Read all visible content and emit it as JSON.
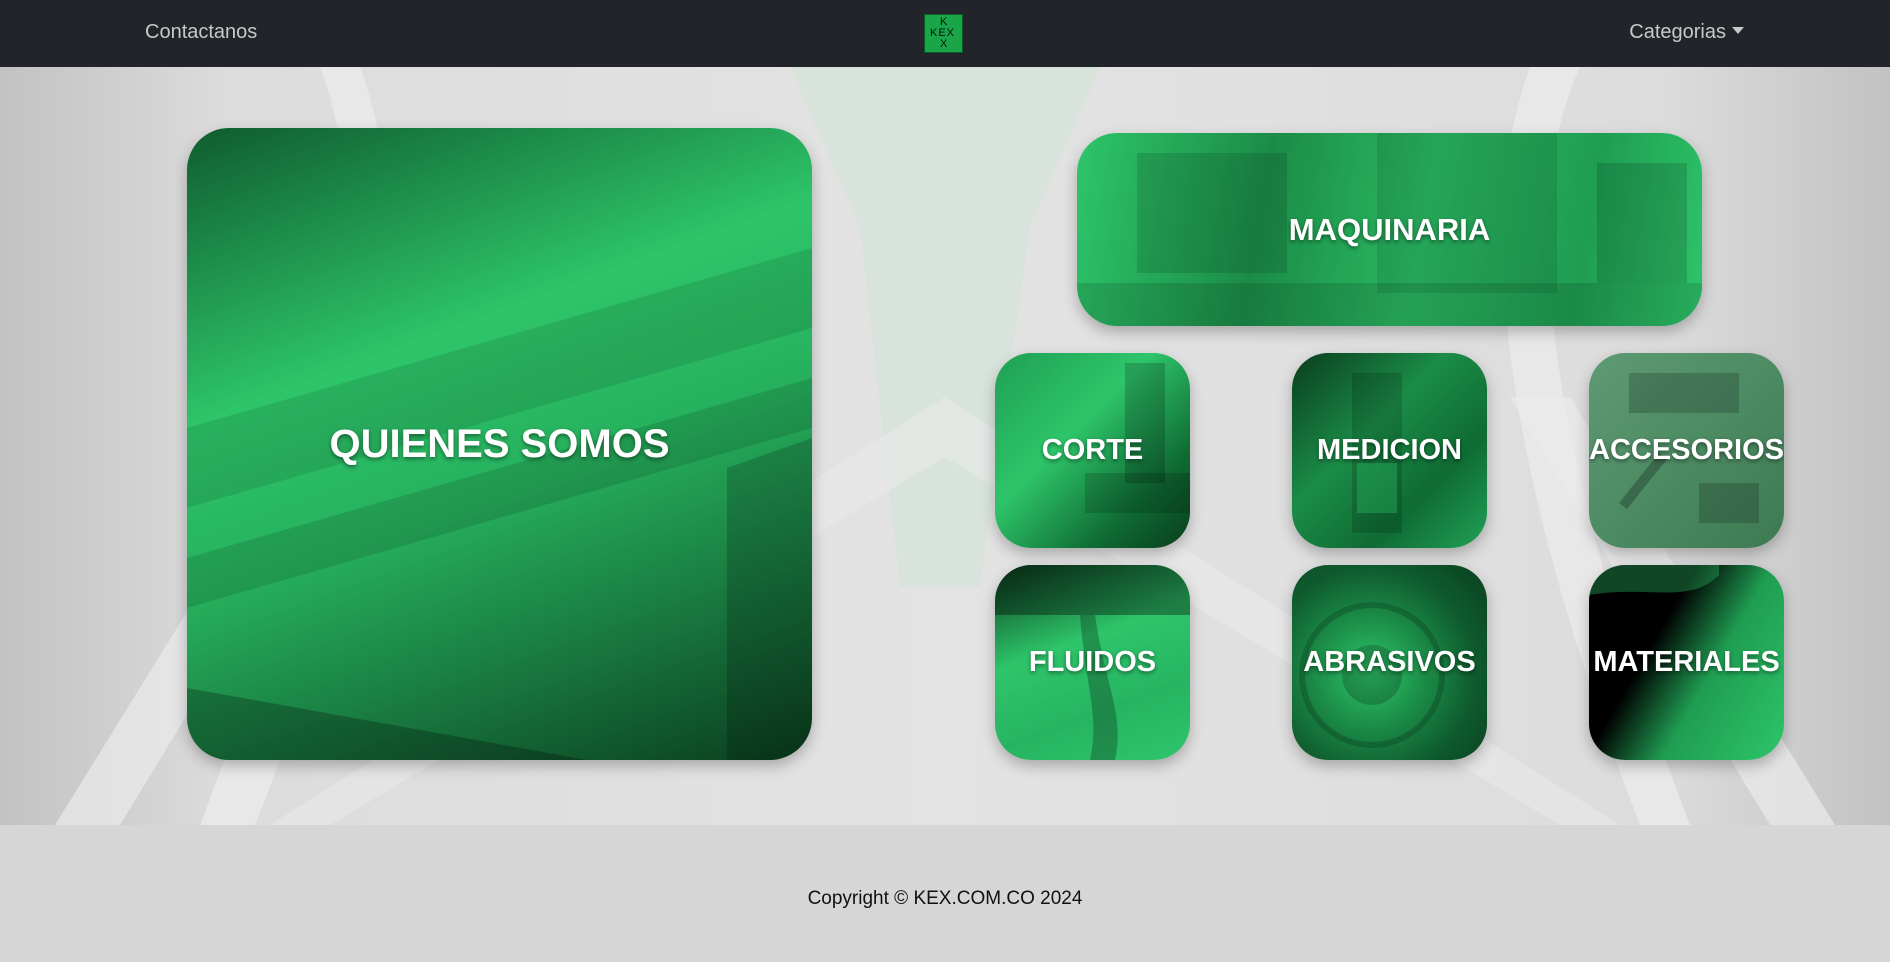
{
  "navbar": {
    "contact_label": "Contactanos",
    "categories_label": "Categorias",
    "logo_text": [
      "K",
      "KEX",
      "X"
    ]
  },
  "cards": {
    "quienes_somos": "QUIENES SOMOS",
    "maquinaria": "MAQUINARIA",
    "corte": "CORTE",
    "medicion": "MEDICION",
    "accesorios": "ACCESORIOS",
    "fluidos": "FLUIDOS",
    "abrasivos": "ABRASIVOS",
    "materiales": "MATERIALES"
  },
  "footer": {
    "copyright": "Copyright © KEX.COM.CO 2024"
  },
  "colors": {
    "navbar_bg": "#212529",
    "brand_green": "#2ec56a",
    "logo_green": "#1aa648",
    "footer_bg": "#d6d6d6"
  }
}
